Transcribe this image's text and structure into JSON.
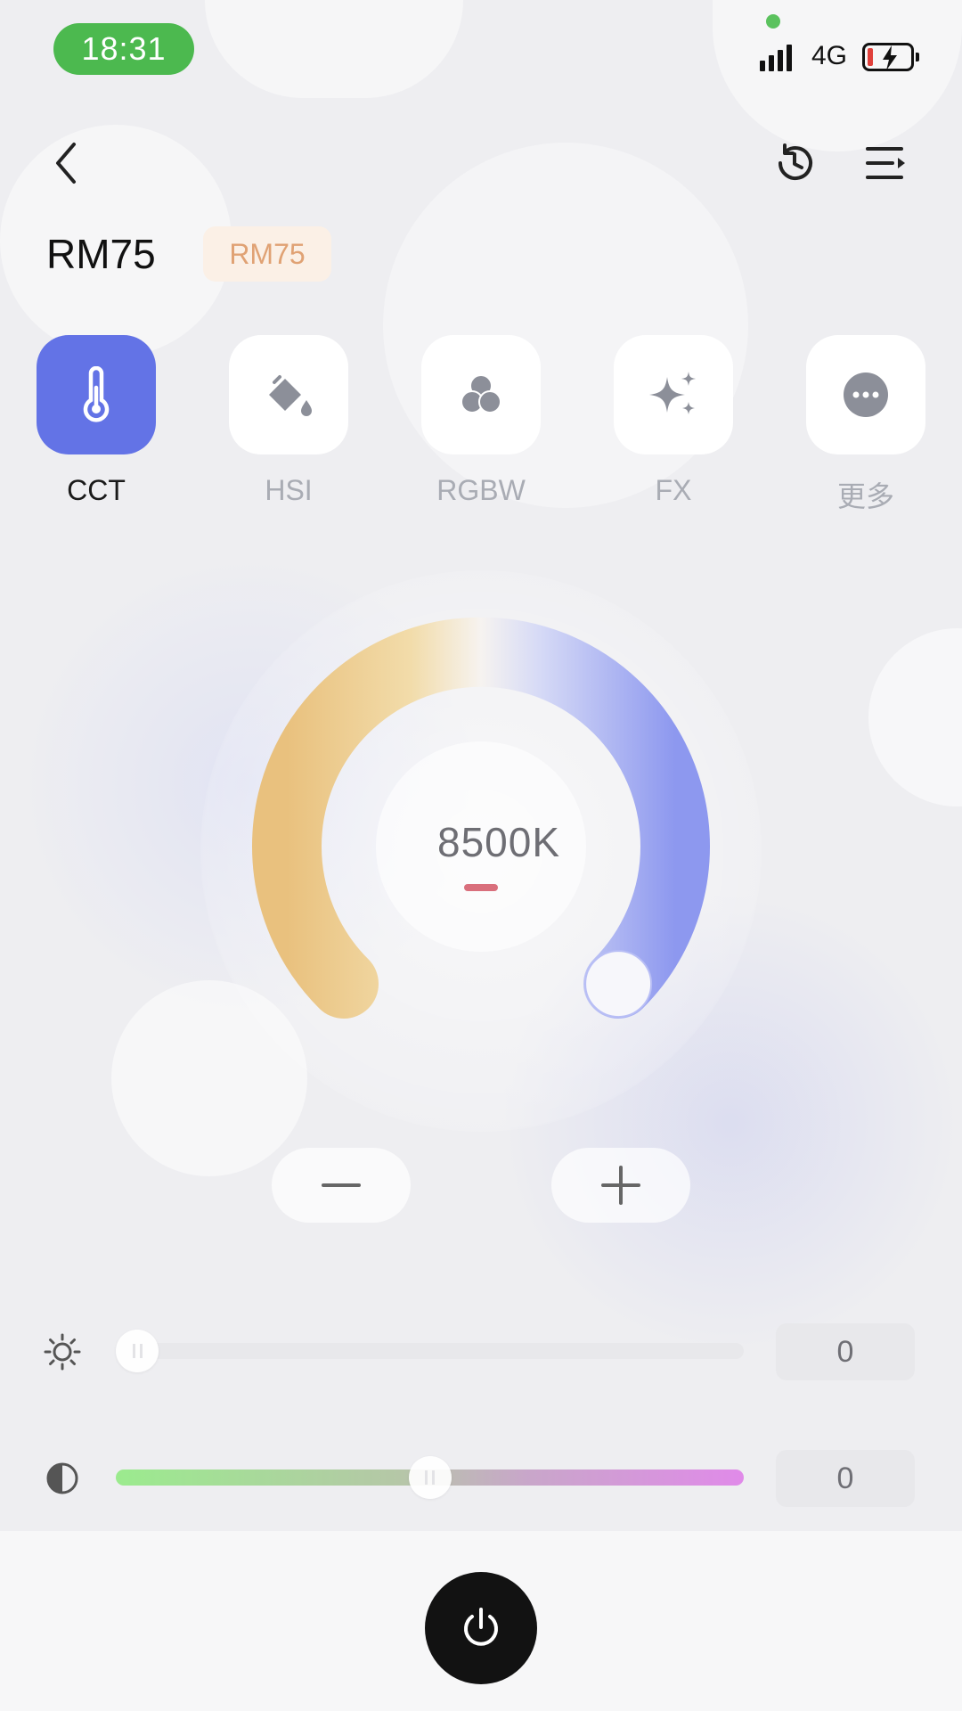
{
  "status_bar": {
    "time": "18:31",
    "network": "4G",
    "battery_level": 0.12,
    "charging": true
  },
  "header": {
    "back_icon": "chevron-left-icon",
    "history_icon": "history-icon",
    "menu_icon": "list-menu-icon"
  },
  "device": {
    "name": "RM75",
    "badge": "RM75"
  },
  "modes": [
    {
      "label": "CCT",
      "icon": "thermometer-icon",
      "active": true
    },
    {
      "label": "HSI",
      "icon": "paint-bucket-icon",
      "active": false
    },
    {
      "label": "RGBW",
      "icon": "rgb-circles-icon",
      "active": false
    },
    {
      "label": "FX",
      "icon": "sparkle-icon",
      "active": false
    },
    {
      "label": "更多",
      "icon": "more-dots-icon",
      "active": false
    }
  ],
  "cct_dial": {
    "value_text": "8500K",
    "position_fraction": 1.0,
    "warm_color": "#e9c17e",
    "cool_color": "#8d98ef"
  },
  "controls": {
    "decrement_icon": "minus-icon",
    "increment_icon": "plus-icon"
  },
  "sliders": {
    "brightness": {
      "icon": "sun-icon",
      "value": "0",
      "fraction": 0.0
    },
    "tint": {
      "icon": "contrast-icon",
      "value": "0",
      "fraction": 0.5
    }
  },
  "power": {
    "icon": "power-icon"
  },
  "colors": {
    "accent": "#6373e6",
    "status_green": "#4cb94f",
    "badge_bg": "#fbf0e6",
    "badge_text": "#e0a274"
  }
}
